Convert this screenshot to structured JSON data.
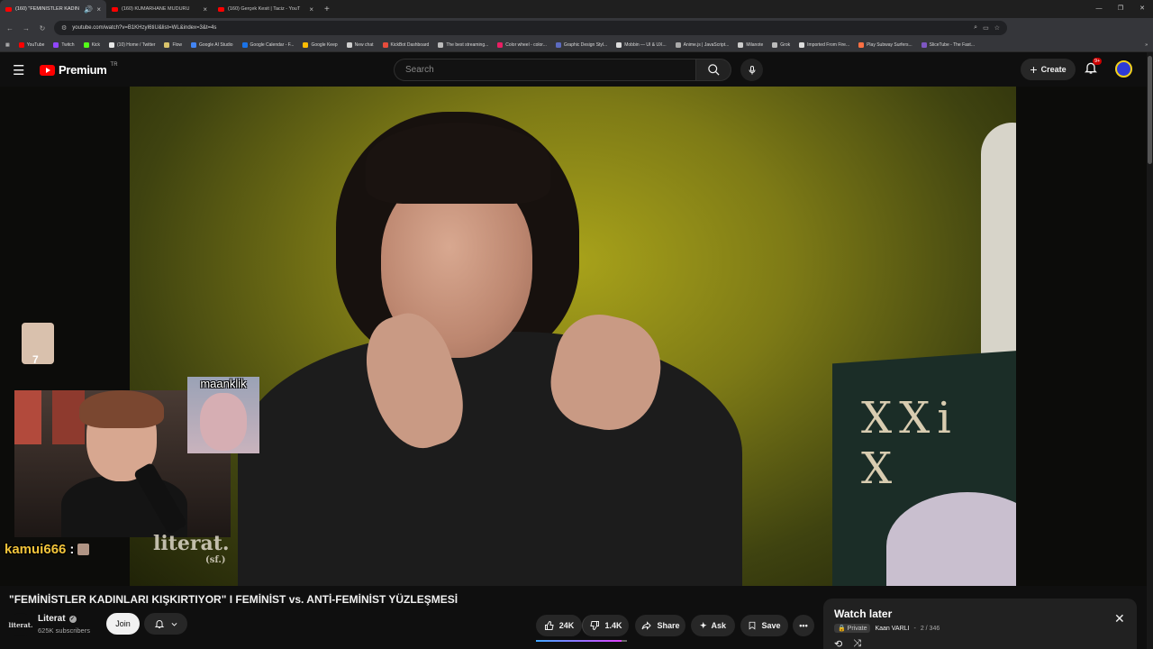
{
  "browser": {
    "tabs": [
      {
        "title": "(160) \"FEMİNİSTLER KADIN",
        "active": true,
        "audio": true
      },
      {
        "title": "(160) KUMARHANE MÜDÜRÜ",
        "active": false
      },
      {
        "title": "(160) Gerçek Kesit | Taciz - YouT",
        "active": false
      }
    ],
    "url": "youtube.com/watch?v=B1KHzyI6tiU&list=WL&index=3&t=4s",
    "bookmarks": [
      {
        "label": "YouTube",
        "color": "#ff0000"
      },
      {
        "label": "Twitch",
        "color": "#9146ff"
      },
      {
        "label": "Kick",
        "color": "#53fc18"
      },
      {
        "label": "(10) Home / Twitter",
        "color": "#e7e7e7"
      },
      {
        "label": "Flow",
        "color": "#d9c36b"
      },
      {
        "label": "Google AI Studio",
        "color": "#4285f4"
      },
      {
        "label": "Google Calendar - F...",
        "color": "#1a73e8"
      },
      {
        "label": "Google Keep",
        "color": "#fbbc04"
      },
      {
        "label": "New chat",
        "color": "#cfcfcf"
      },
      {
        "label": "KickBot Dashboard",
        "color": "#e74c3c"
      },
      {
        "label": "The best streaming...",
        "color": "#bbbbbb"
      },
      {
        "label": "Color wheel - color...",
        "color": "#e91e63"
      },
      {
        "label": "Graphic Design Styl...",
        "color": "#5c6bc0"
      },
      {
        "label": "Mobbin — UI & UX...",
        "color": "#dddddd"
      },
      {
        "label": "Anime.js | JavaScript...",
        "color": "#aaaaaa"
      },
      {
        "label": "Milanote",
        "color": "#cccccc"
      },
      {
        "label": "Grok",
        "color": "#bbbbbb"
      },
      {
        "label": "Imported From Fire...",
        "color": "#dddddd"
      },
      {
        "label": "Play Subway Surfers...",
        "color": "#ff7043"
      },
      {
        "label": "SliceTube - The Fast...",
        "color": "#7e57c2"
      }
    ]
  },
  "youtube": {
    "brand": "Premium",
    "country": "TR",
    "search_placeholder": "Search",
    "create_label": "Create",
    "notif_badge": "9+"
  },
  "overlay": {
    "sticker_number": "7",
    "emote_label": "maanklik",
    "chat_user": "kamui666",
    "chat_colon": ":",
    "watermark": "literat.",
    "watermark_sub": "(sf.)",
    "chair_text": "XXi X"
  },
  "video": {
    "title": "\"FEMİNİSTLER KADINLARI KIŞKIRTIYOR\" I FEMİNİST vs. ANTİ-FEMİNİST YÜZLEŞMESİ",
    "channel": "Literat",
    "channel_logo": "literat.",
    "subscribers": "625K subscribers",
    "join": "Join",
    "likes": "24K",
    "dislikes": "1.4K",
    "share": "Share",
    "ask": "Ask",
    "save": "Save",
    "like_ratio": 0.945
  },
  "watch_later": {
    "title": "Watch later",
    "privacy": "Private",
    "owner": "Kaan VARLI",
    "position": "2 / 346"
  }
}
